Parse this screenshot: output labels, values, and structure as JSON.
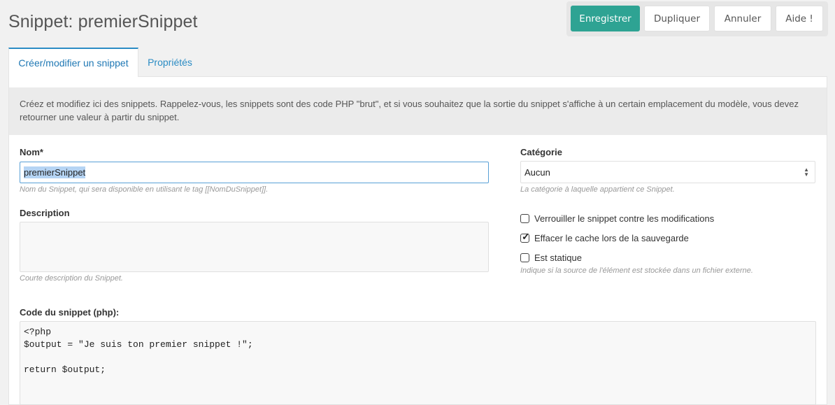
{
  "header": {
    "title": "Snippet: premierSnippet"
  },
  "actions": {
    "save": "Enregistrer",
    "duplicate": "Dupliquer",
    "cancel": "Annuler",
    "help": "Aide !"
  },
  "tabs": [
    {
      "label": "Créer/modifier un snippet",
      "active": true
    },
    {
      "label": "Propriétés",
      "active": false
    }
  ],
  "intro": "Créez et modifiez ici des snippets. Rappelez-vous, les snippets sont des code PHP \"brut\", et si vous souhaitez que la sortie du snippet s'affiche à un certain emplacement du modèle, vous devez retourner une valeur à partir du snippet.",
  "form": {
    "name": {
      "label": "Nom*",
      "value": "premierSnippet",
      "help": "Nom du Snippet, qui sera disponible en utilisant le tag [[NomDuSnippet]]."
    },
    "description": {
      "label": "Description",
      "value": "",
      "help": "Courte description du Snippet."
    },
    "category": {
      "label": "Catégorie",
      "value": "Aucun",
      "help": "La catégorie à laquelle appartient ce Snippet."
    },
    "lock": {
      "label": "Verrouiller le snippet contre les modifications",
      "checked": false
    },
    "clear_cache": {
      "label": "Effacer le cache lors de la sauvegarde",
      "checked": true
    },
    "static": {
      "label": "Est statique",
      "checked": false,
      "help": "Indique si la source de l'élément est stockée dans un fichier externe."
    },
    "code": {
      "label": "Code du snippet (php):",
      "value": "<?php\n$output = \"Je suis ton premier snippet !\";\n\nreturn $output;"
    }
  },
  "colors": {
    "primary": "#2ea393",
    "link": "#2b8cc4",
    "background": "#f1f1f1"
  }
}
